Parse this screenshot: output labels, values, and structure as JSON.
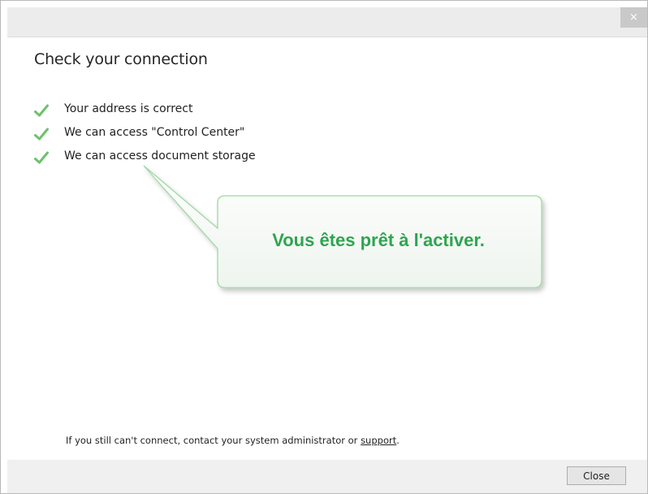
{
  "window": {
    "close_glyph": "×"
  },
  "main": {
    "heading": "Check your connection",
    "checks": [
      {
        "label": "Your address is correct",
        "icon": "checkmark-icon"
      },
      {
        "label": "We can access \"Control Center\"",
        "icon": "checkmark-icon"
      },
      {
        "label": "We can access document storage",
        "icon": "checkmark-icon"
      }
    ],
    "callout": {
      "text": "Vous êtes prêt à l'activer."
    },
    "footer_note": {
      "text": "If you still can't connect, contact your system administrator or ",
      "link": "support",
      "suffix": "."
    }
  },
  "bottom_bar": {
    "close_label": "Close"
  },
  "colors": {
    "check_green": "#6cc26a",
    "callout_text": "#2ea54f",
    "callout_border": "#9ed9a3",
    "titlebar": "#ececec",
    "bottombar": "#f0f0f0"
  }
}
